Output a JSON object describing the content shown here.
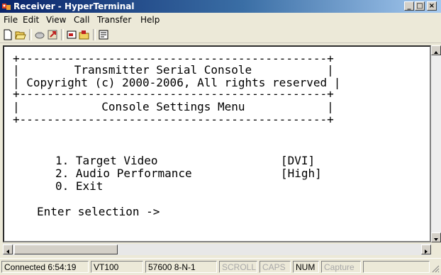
{
  "window": {
    "title": "Receiver - HyperTerminal"
  },
  "menubar": {
    "items": [
      "File",
      "Edit",
      "View",
      "Call",
      "Transfer",
      "Help"
    ]
  },
  "toolbar": {
    "buttons": [
      "new-icon",
      "open-icon",
      "dial-icon",
      "disconnect-icon",
      "send-icon",
      "receive-icon",
      "properties-icon"
    ]
  },
  "terminal": {
    "border_top": "+---------------------------------------------+",
    "header_line1": "|        Transmitter Serial Console           |",
    "header_line2": "| Copyright (c) 2000-2006, All rights reserved |",
    "border_mid": "+---------------------------------------------+",
    "menu_title": "|            Console Settings Menu            |",
    "border_bottom": "+---------------------------------------------+",
    "option1_label": "1. Target Video",
    "option1_value": "[DVI]",
    "option2_label": "2. Audio Performance",
    "option2_value": "[High]",
    "option0_label": "0. Exit",
    "prompt": "Enter selection ->"
  },
  "statusbar": {
    "connected": "Connected 6:54:19",
    "emulation": "VT100",
    "settings": "57600 8-N-1",
    "scroll": "SCROLL",
    "caps": "CAPS",
    "num": "NUM",
    "capture": "Capture"
  }
}
